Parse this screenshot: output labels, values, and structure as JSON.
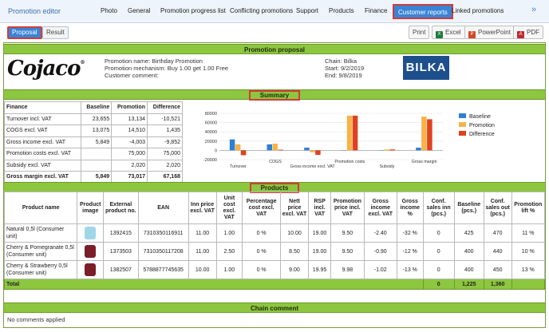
{
  "header": {
    "title": "Promotion editor",
    "tabs": [
      "Photo",
      "General",
      "Promotion progress list",
      "Conflicting promotions",
      "Support",
      "Products",
      "Finance",
      "Customer reports",
      "Linked promotions"
    ],
    "active_tab": "Customer reports"
  },
  "toolbar": {
    "proposal": "Proposal",
    "result": "Result",
    "print": "Print",
    "excel": "Excel",
    "powerpoint": "PowerPoint",
    "pdf": "PDF"
  },
  "report": {
    "title": "Promotion proposal",
    "logo": "Cojaco",
    "promo_name": "Promotion name: Birthday Promotion",
    "promo_mech": "Promotion mechanism: Buy 1.00 get 1.00 Free",
    "customer_comment": "Customer comment:",
    "chain": "Chain: Bilka",
    "start": "Start: 9/2/2019",
    "end": "End: 9/8/2019",
    "chain_logo": "BILKA",
    "summary_title": "Summary",
    "finance_headers": [
      "Finance",
      "Baseline",
      "Promotion",
      "Difference"
    ],
    "finance_rows": [
      [
        "Turnover incl. VAT",
        "23,655",
        "13,134",
        "-10,521"
      ],
      [
        "COGS excl. VAT",
        "13,075",
        "14,510",
        "1,435"
      ],
      [
        "Gross income excl. VAT",
        "5,849",
        "-4,003",
        "-9,852"
      ],
      [
        "Promotion costs excl. VAT",
        "",
        "75,000",
        "75,000"
      ],
      [
        "Subsidy excl. VAT",
        "",
        "2,020",
        "2,020"
      ],
      [
        "Gross margin excl. VAT",
        "5,849",
        "73,017",
        "67,168"
      ]
    ],
    "products_title": "Products",
    "product_headers": [
      "Product name",
      "Product image",
      "External product no.",
      "EAN",
      "Inn price excl. VAT",
      "Unit cost excl. VAT",
      "Percentage cost excl. VAT",
      "Nett price excl. VAT",
      "RSP incl. VAT",
      "Promotion price incl. VAT",
      "Gross income excl. VAT",
      "Gross income %",
      "Conf. sales inn (pcs.)",
      "Baseline (pcs.)",
      "Conf. sales out (pcs.)",
      "Promotion lift %"
    ],
    "products": [
      {
        "name": "Natural 0,5l (Consumer unit)",
        "img": "bottle-image",
        "cells": [
          "1392415",
          "7310350116911",
          "11.00",
          "1.00",
          "0 %",
          "10.00",
          "19.00",
          "9.50",
          "-2.40",
          "-32 %",
          "0",
          "425",
          "470",
          "11 %"
        ]
      },
      {
        "name": "Cherry & Pomegranate 0,5l (Consumer unit)",
        "img": "can-image",
        "cells": [
          "1373503",
          "7310350117208",
          "11.00",
          "2.50",
          "0 %",
          "8.50",
          "19.00",
          "9.50",
          "-0.90",
          "-12 %",
          "0",
          "400",
          "440",
          "10 %"
        ]
      },
      {
        "name": "Cherry & Strawberry 0,5l (Consumer unit)",
        "img": "can-image",
        "cells": [
          "1382507",
          "5788877745635",
          "10.00",
          "1.00",
          "0 %",
          "9.00",
          "19.95",
          "9.98",
          "-1.02",
          "-13 %",
          "0",
          "400",
          "450",
          "13 %"
        ]
      }
    ],
    "total_label": "Total",
    "total_conf_inn": "0",
    "total_baseline": "1,225",
    "total_conf_out": "1,360",
    "chain_comment_title": "Chain comment",
    "chain_comment": "No comments applied"
  },
  "colors": {
    "accent": "#3a84d6",
    "highlight": "#d33b3b",
    "green": "#8dc63f",
    "baseline": "#2e7fd6",
    "promotion": "#f7b24a",
    "difference": "#e0411f"
  },
  "chart_data": {
    "type": "bar",
    "categories": [
      "Turnover",
      "COGS",
      "Gross income excl. VAT",
      "Promotion costs",
      "Subsidy",
      "Gross margin"
    ],
    "series": [
      {
        "name": "Baseline",
        "values": [
          23655,
          13075,
          5849,
          0,
          0,
          5849
        ]
      },
      {
        "name": "Promotion",
        "values": [
          13134,
          14510,
          -4003,
          75000,
          2020,
          73017
        ]
      },
      {
        "name": "Difference",
        "values": [
          -10521,
          1435,
          -9852,
          75000,
          2020,
          67168
        ]
      }
    ],
    "yticks": [
      "80000",
      "60000",
      "40000",
      "20000",
      "0",
      "-20000"
    ],
    "ylim": [
      -20000,
      80000
    ],
    "legend": "right"
  }
}
